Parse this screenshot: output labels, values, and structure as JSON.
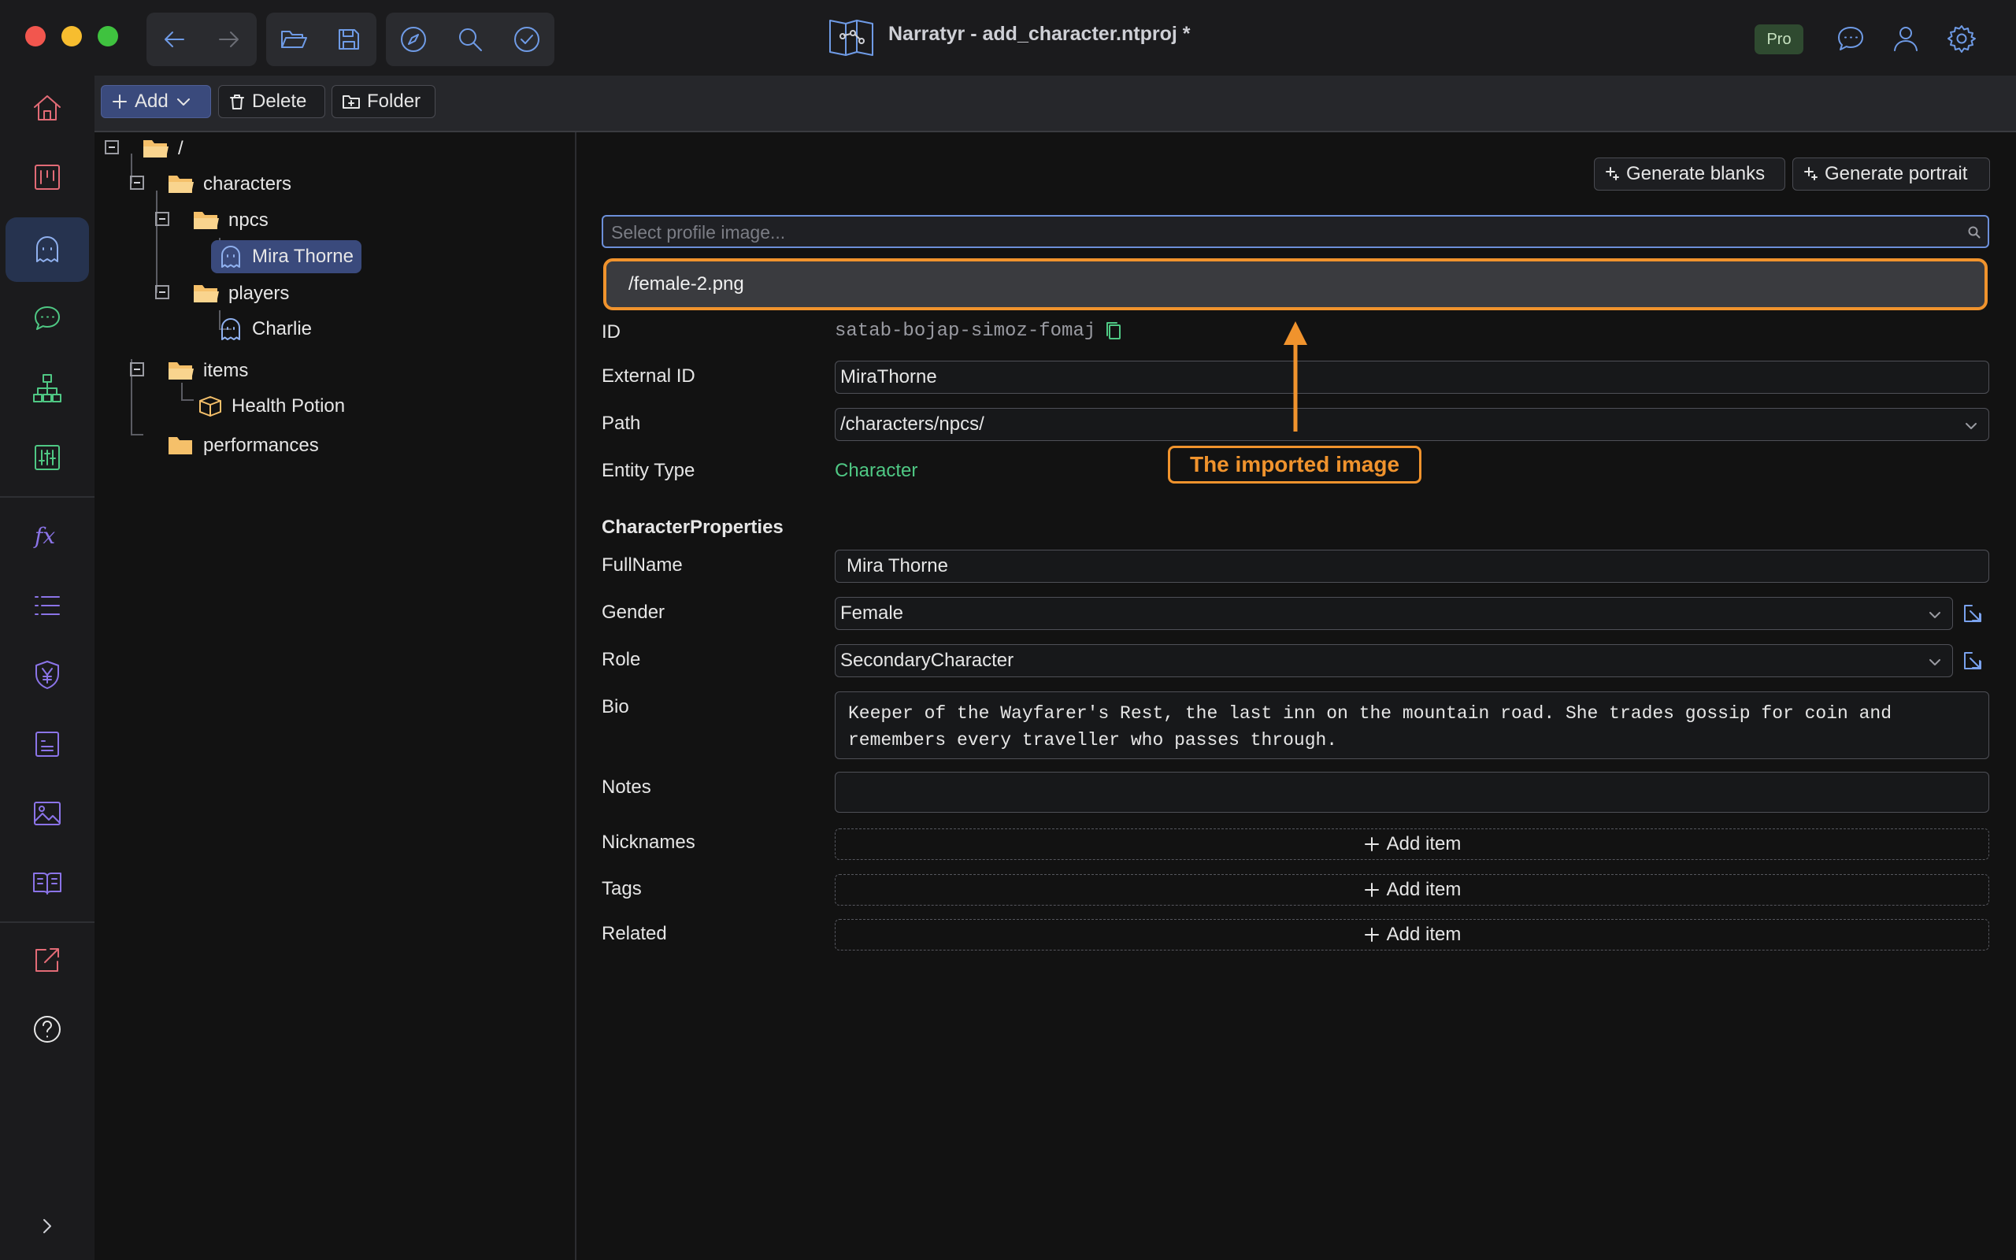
{
  "window": {
    "title": "Narratyr - add_character.ntproj *",
    "pro_badge": "Pro",
    "traffic_lights": [
      "#f2564e",
      "#f7bd2f",
      "#3fc23f"
    ]
  },
  "toolbar": {
    "add_label": "Add",
    "delete_label": "Delete",
    "folder_label": "Folder"
  },
  "tree": {
    "root": "/",
    "characters": "characters",
    "npcs": "npcs",
    "mira": "Mira Thorne",
    "players": "players",
    "charlie": "Charlie",
    "items": "items",
    "health_potion": "Health Potion",
    "performances": "performances"
  },
  "editor": {
    "generate_blanks": "Generate blanks",
    "generate_portrait": "Generate portrait",
    "profile_placeholder": "Select profile image...",
    "dropdown_option": "/female-2.png",
    "id_label": "ID",
    "id_value": "satab-bojap-simoz-fomaj",
    "external_id_label": "External ID",
    "external_id_value": "MiraThorne",
    "path_label": "Path",
    "path_value": "/characters/npcs/",
    "entity_type_label": "Entity Type",
    "entity_type_value": "Character",
    "section_title": "CharacterProperties",
    "fullname_label": "FullName",
    "fullname_value": "Mira Thorne",
    "gender_label": "Gender",
    "gender_value": "Female",
    "role_label": "Role",
    "role_value": "SecondaryCharacter",
    "bio_label": "Bio",
    "bio_line1": "Keeper of the Wayfarer's Rest, the last inn on the mountain road. She trades gossip for coin and",
    "bio_line2": "remembers every traveller who passes through.",
    "notes_label": "Notes",
    "notes_value": "",
    "nicknames_label": "Nicknames",
    "tags_label": "Tags",
    "related_label": "Related",
    "add_item_label": "Add item"
  },
  "annotation": {
    "text": "The imported image"
  },
  "colors": {
    "accent": "#3a4a7c",
    "annotation": "#f0932d",
    "entity_type": "#4fc884",
    "folder": "#f5c06a",
    "nav_icon": "#6f9be6"
  }
}
